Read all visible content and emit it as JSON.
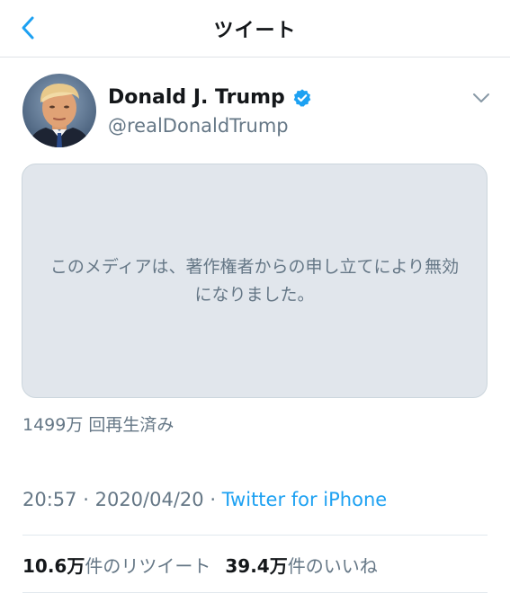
{
  "header": {
    "title": "ツイート",
    "back_icon": "chevron-left-icon"
  },
  "tweet": {
    "author": {
      "name": "Donald J. Trump",
      "handle": "@realDonaldTrump",
      "verified": true,
      "verified_color": "#1da1f2"
    },
    "media": {
      "message": "このメディアは、著作権者からの申し立てにより無効になりました。"
    },
    "view_count": "1499万 回再生済み",
    "time": "20:57",
    "separator": "·",
    "date": "2020/04/20",
    "source": "Twitter for iPhone",
    "stats": {
      "retweets_num": "10.6万",
      "retweets_label": "件のリツイート",
      "likes_num": "39.4万",
      "likes_label": "件のいいね"
    }
  },
  "colors": {
    "accent": "#1da1f2",
    "muted": "#657786",
    "media_bg": "#e1e6ec"
  }
}
